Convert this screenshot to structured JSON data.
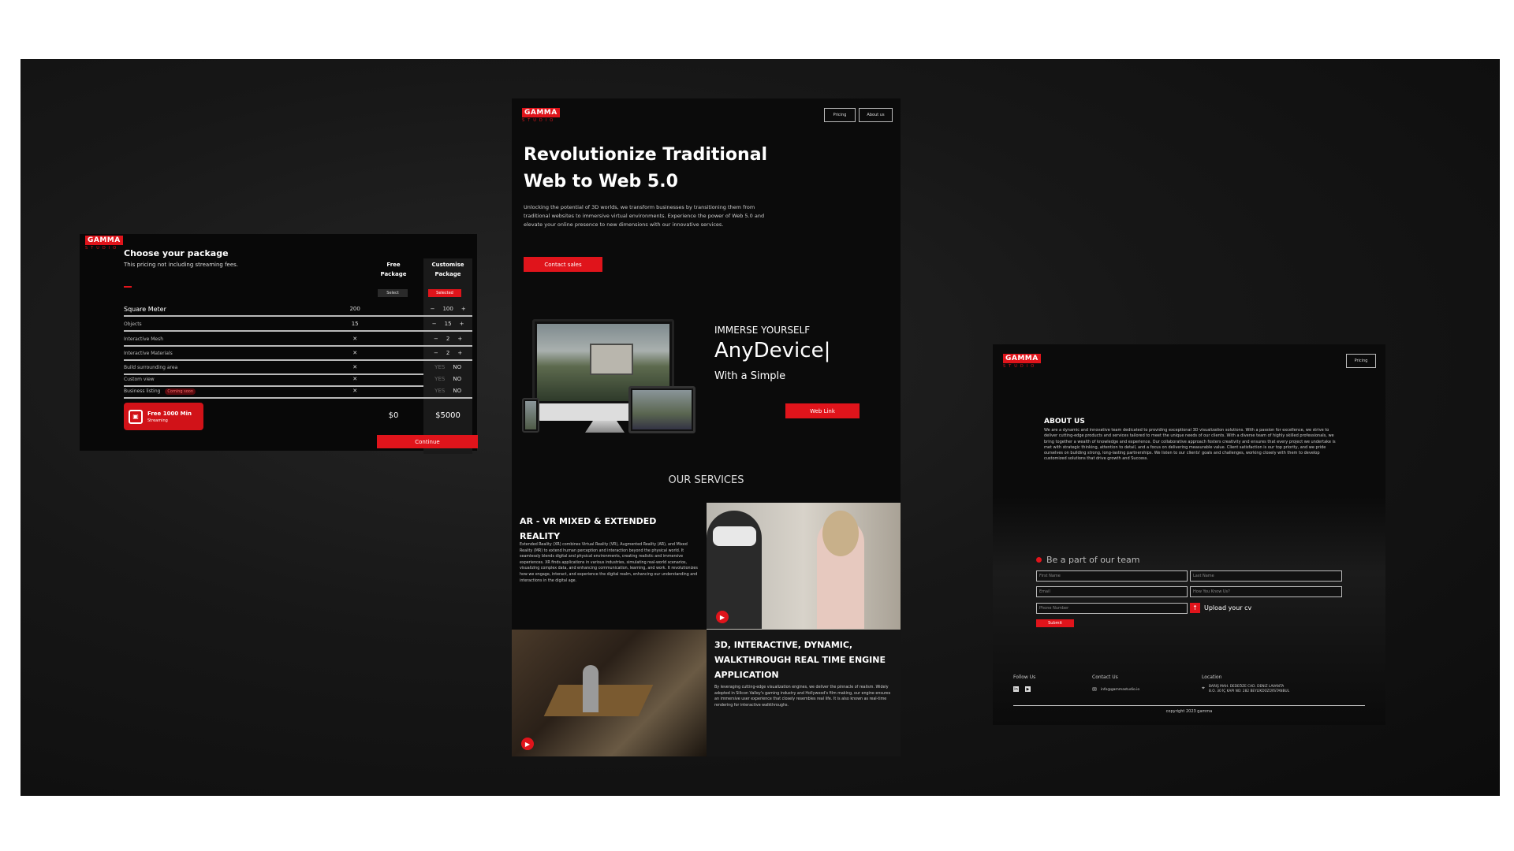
{
  "pricing": {
    "title": "Choose your package",
    "subtitle": "This pricing not including streaming fees.",
    "col_free": "Free Package",
    "col_custom": "Customise Package",
    "select_label": "Select",
    "selected_label": "Selected",
    "rows": [
      {
        "label": "Square Meter",
        "free": "200",
        "custom": "100",
        "stepper": true
      },
      {
        "label": "Objects",
        "free": "15",
        "custom": "15",
        "stepper": true
      },
      {
        "label": "Interactive Mesh",
        "free": "✕",
        "custom": "2",
        "stepper": true
      },
      {
        "label": "Interactive Materials",
        "free": "✕",
        "custom": "2",
        "stepper": true
      },
      {
        "label": "Build surrounding area",
        "free": "✕",
        "yes": "YES",
        "no": "NO"
      },
      {
        "label": "Custom view",
        "free": "✕",
        "yes": "YES",
        "no": "NO"
      },
      {
        "label": "Business listing",
        "badge": "Coming soon",
        "free": "✕",
        "yes": "YES",
        "no": "NO"
      }
    ],
    "minus": "−",
    "plus": "+",
    "promo_title": "Free 1000 Min",
    "promo_sub": "Streaming",
    "price_free": "$0",
    "price_custom": "$5000",
    "continue_label": "Continue"
  },
  "home": {
    "logo": "GAMMA",
    "logo_sub": "STUDIO",
    "nav": [
      "Pricing",
      "About us"
    ],
    "hero_title_1": "Revolutionize Traditional",
    "hero_title_2": "Web to Web 5.0",
    "hero_text": "Unlocking the potential of 3D worlds, we transform businesses by transitioning them from traditional websites to immersive virtual environments. Experience the power of Web 5.0 and elevate your online presence to new dimensions with our innovative services.",
    "cta": "Contact sales",
    "immerse": "IMMERSE YOURSELF",
    "device": "AnyDevice|",
    "simple": "With a Simple",
    "weblink": "Web Link",
    "services_title": "OUR SERVICES",
    "s1_title": "AR - VR MIXED & EXTENDED REALITY",
    "s1_text": "Extended Reality (XR) combines Virtual Reality (VR), Augmented Reality (AR), and Mixed Reality (MR) to extend human perception and interaction beyond the physical world. It seamlessly blends digital and physical environments, creating realistic and immersive experiences. XR finds applications in various industries, simulating real-world scenarios, visualizing complex data, and enhancing communication, learning, and work. It revolutionizes how we engage, interact, and experience the digital realm, enhancing our understanding and interactions in the digital age.",
    "s2_title": "3D, INTERACTIVE, DYNAMIC, WALKTHROUGH REAL TIME ENGINE APPLICATION",
    "s2_text": "By leveraging cutting-edge visualization engines, we deliver the pinnacle of realism. Widely adopted in Silicon Valley's gaming industry and Hollywood's film making, our engine ensures an immersive user experience that closely resembles real life. It is also known as real-time rendering for interactive walkthroughs."
  },
  "about": {
    "logo": "GAMMA",
    "logo_sub": "STUDIO",
    "nav": "Pricing",
    "title": "ABOUT US",
    "text": "We are a dynamic and innovative team dedicated to providing exceptional 3D visualization solutions. With a passion for excellence, we strive to deliver cutting-edge products and services tailored to meet the unique needs of our clients. With a diverse team of highly skilled professionals, we bring together a wealth of knowledge and experience. Our collaborative approach fosters creativity and ensures that every project we undertake is met with strategic thinking, attention to detail, and a focus on delivering measurable value. Client satisfaction is our top priority, and we pride ourselves on building strong, long-lasting partnerships. We listen to our clients' goals and challenges, working closely with them to develop customized solutions that drive growth and Success.",
    "team_title": "Be a part of our team",
    "fields": {
      "first": "First Name",
      "last": "Last Name",
      "email": "Email",
      "how": "How You Know Us?",
      "phone": "Phone Number"
    },
    "upload": "Upload your cv",
    "submit": "Submit",
    "follow": "Follow Us",
    "contact": "Contact Us",
    "email": "info@gammastudio.io",
    "location": "Location",
    "address_1": "BARIŞ MAH. DEDEÖZE CAD. DENIZ LAVANTA",
    "address_2": "B.O. 30 İÇ KAPI NO: 282 BEYLİKDÜZÜ/İSTANBUL",
    "copyright": "copyright 2023 gamma",
    "colors": {
      "accent": "#e0141b"
    }
  }
}
